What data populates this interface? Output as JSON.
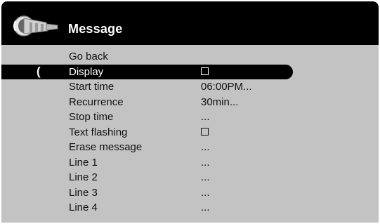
{
  "header": {
    "title": "Message",
    "logo_icon": "cable-plug-icon"
  },
  "selected_marker": "(",
  "rows": [
    {
      "label": "Go back",
      "value": ""
    },
    {
      "label": "Display",
      "value": "",
      "checkbox": true
    },
    {
      "label": "Start time",
      "value": "06:00PM..."
    },
    {
      "label": "Recurrence",
      "value": "30min..."
    },
    {
      "label": "Stop time",
      "value": "..."
    },
    {
      "label": "Text flashing",
      "value": "",
      "checkbox": true
    },
    {
      "label": "Erase message",
      "value": "..."
    },
    {
      "label": "Line 1",
      "value": "..."
    },
    {
      "label": "Line 2",
      "value": "..."
    },
    {
      "label": "Line 3",
      "value": "..."
    },
    {
      "label": "Line 4",
      "value": "..."
    }
  ],
  "colors": {
    "panel": "#c3c3c3",
    "header": "#000000",
    "selected": "#000000"
  }
}
